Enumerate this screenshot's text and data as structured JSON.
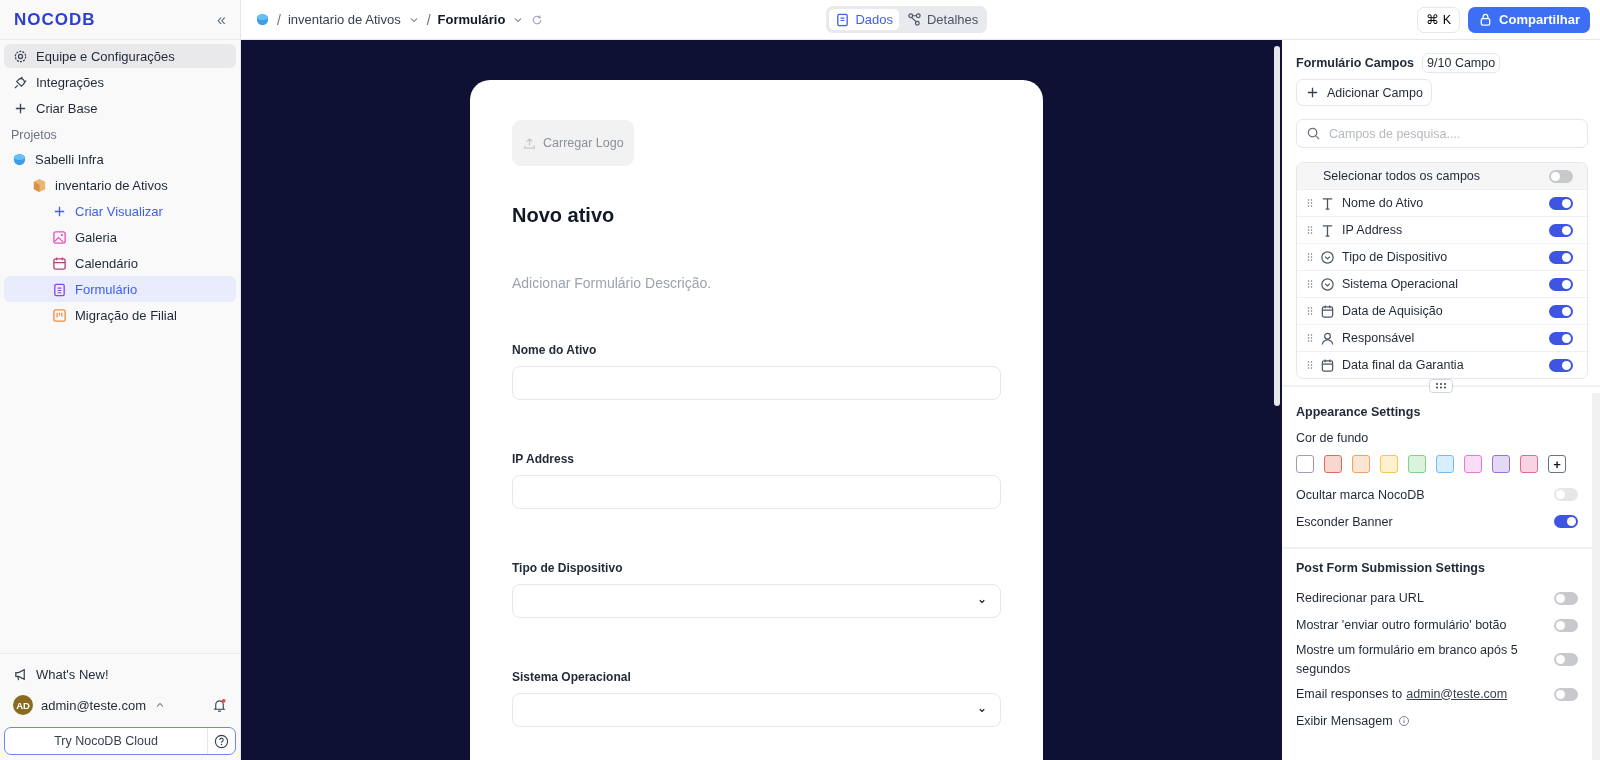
{
  "sidebar": {
    "logo": "NOCODB",
    "collapse": "«",
    "nav": [
      {
        "kind": "settings",
        "label": "Equipe e Configurações",
        "selected": true
      },
      {
        "kind": "integrations",
        "label": "Integrações",
        "selected": false
      },
      {
        "kind": "add",
        "label": "Criar Base",
        "selected": false
      }
    ],
    "section": "Projetos",
    "project": {
      "label": "Sabelli Infra",
      "children": [
        {
          "label": "inventario de Ativos",
          "children": [
            {
              "kind": "create",
              "label": "Criar Visualizar",
              "selected": false
            },
            {
              "kind": "gallery",
              "label": "Galeria",
              "selected": false
            },
            {
              "kind": "calendar",
              "label": "Calendário",
              "selected": false
            },
            {
              "kind": "form",
              "label": "Formulário",
              "selected": true
            },
            {
              "kind": "kanban",
              "label": "Migração de Filial",
              "selected": false
            }
          ]
        }
      ]
    },
    "whats_new": "What's New!",
    "user": {
      "initials": "AD",
      "email": "admin@teste.com"
    },
    "cloud": "Try NocoDB Cloud"
  },
  "topbar": {
    "separator": "/",
    "breadcrumbs": [
      "inventario de Ativos",
      "Formulário"
    ],
    "tabs": [
      {
        "kind": "data",
        "label": "Dados",
        "selected": true
      },
      {
        "kind": "details",
        "label": "Detalhes",
        "selected": false
      }
    ],
    "shortcut": "⌘ K",
    "share": "Compartilhar"
  },
  "form": {
    "logo_button": "Carregar Logo",
    "title": "Novo ativo",
    "description_placeholder": "Adicionar Formulário Descrição.",
    "fields": [
      {
        "label": "Nome do Ativo",
        "kind": "text"
      },
      {
        "label": "IP Address",
        "kind": "text"
      },
      {
        "label": "Tipo de Dispositivo",
        "kind": "select"
      },
      {
        "label": "Sistema Operacional",
        "kind": "select"
      }
    ]
  },
  "panel": {
    "title": "Formulário Campos",
    "count": "9/10 Campo",
    "add_field": "Adicionar Campo",
    "search_placeholder": "Campos de pesquisa....",
    "select_all": {
      "label": "Selecionar todos os campos",
      "on": false
    },
    "fields": [
      {
        "kind": "text",
        "label": "Nome do Ativo",
        "on": true
      },
      {
        "kind": "text",
        "label": "IP Address",
        "on": true
      },
      {
        "kind": "select",
        "label": "Tipo de Dispositivo",
        "on": true
      },
      {
        "kind": "select",
        "label": "Sistema Operacional",
        "on": true
      },
      {
        "kind": "date",
        "label": "Data de Aquisição",
        "on": true
      },
      {
        "kind": "user",
        "label": "Responsável",
        "on": true
      },
      {
        "kind": "date",
        "label": "Data final da Garantia",
        "on": true
      }
    ],
    "appearance": {
      "title": "Appearance Settings",
      "bg_label": "Cor de fundo",
      "swatches": [
        {
          "color": "#ffffff"
        },
        {
          "color": "#f8d7d3"
        },
        {
          "color": "#fbe5d4"
        },
        {
          "color": "#fdf1cf"
        },
        {
          "color": "#d9f3dd"
        },
        {
          "color": "#d9eefe"
        },
        {
          "color": "#f9ddf4"
        },
        {
          "color": "#e3d9f5"
        },
        {
          "color": "#f8d4e3"
        }
      ],
      "add_color": "+",
      "toggles": [
        {
          "label": "Ocultar marca NocoDB",
          "on": false,
          "disabled": true
        },
        {
          "label": "Esconder Banner",
          "on": true,
          "disabled": false
        }
      ]
    },
    "post": {
      "title": "Post Form Submission Settings",
      "toggles": [
        {
          "label": "Redirecionar para URL",
          "on": false
        },
        {
          "label": "Mostrar 'enviar outro formulário' botão",
          "on": false
        },
        {
          "label": "Mostre um formulário em branco após 5 segundos",
          "on": false
        },
        {
          "label": "Email responses to",
          "link": "admin@teste.com",
          "on": false
        }
      ],
      "message": "Exibir Mensagem"
    }
  }
}
